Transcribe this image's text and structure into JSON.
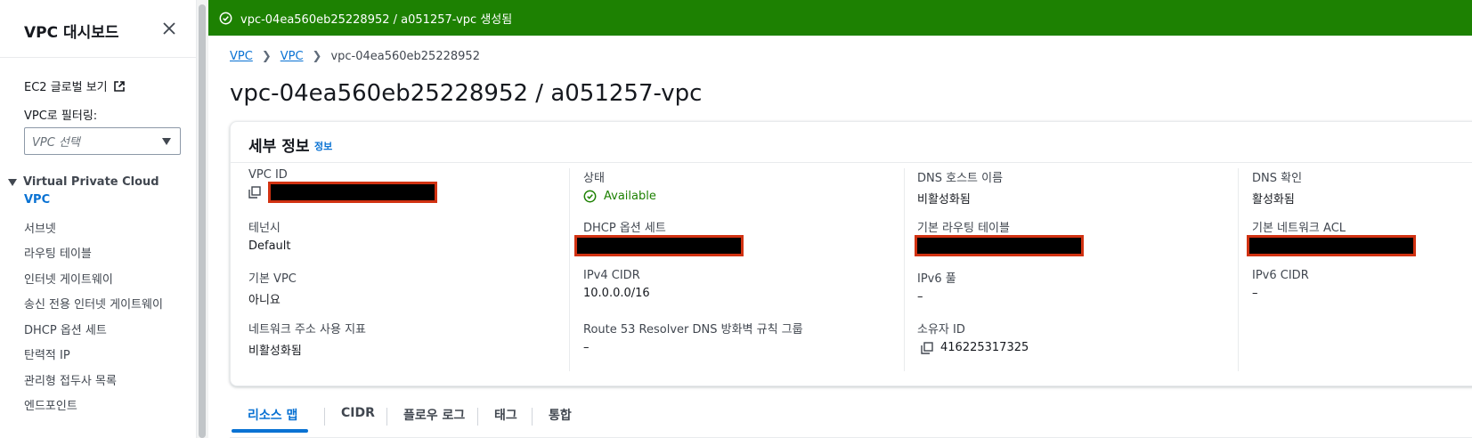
{
  "sidebar": {
    "title": "VPC 대시보드",
    "ec2_link": "EC2 글로벌 보기",
    "filter_label": "VPC로 필터링:",
    "filter_placeholder": "VPC 선택",
    "section": "Virtual Private Cloud",
    "items": [
      {
        "label": "VPC",
        "active": true
      },
      {
        "label": "서브넷"
      },
      {
        "label": "라우팅 테이블"
      },
      {
        "label": "인터넷 게이트웨이"
      },
      {
        "label": "송신 전용 인터넷 게이트웨이"
      },
      {
        "label": "DHCP 옵션 세트"
      },
      {
        "label": "탄력적 IP"
      },
      {
        "label": "관리형 접두사 목록"
      },
      {
        "label": "엔드포인트"
      }
    ]
  },
  "flash": {
    "message": "vpc-04ea560eb25228952 / a051257-vpc 생성됨",
    "color": "#1d8102"
  },
  "breadcrumb": {
    "items": [
      "VPC",
      "VPC"
    ],
    "current": "vpc-04ea560eb25228952"
  },
  "page": {
    "title": "vpc-04ea560eb25228952 / a051257-vpc"
  },
  "details": {
    "title": "세부 정보",
    "info_link": "정보",
    "col1": {
      "vpc_id_label": "VPC ID",
      "tenancy_label": "테넌시",
      "tenancy_value": "Default",
      "default_vpc_label": "기본 VPC",
      "default_vpc_value": "아니요",
      "net_addr_label": "네트워크 주소 사용 지표",
      "net_addr_value": "비활성화됨"
    },
    "col2": {
      "state_label": "상태",
      "state_value": "Available",
      "dhcp_label": "DHCP 옵션 세트",
      "ipv4_label": "IPv4 CIDR",
      "ipv4_value": "10.0.0.0/16",
      "route53_label": "Route 53 Resolver DNS 방화벽 규칙 그룹",
      "route53_value": "–"
    },
    "col3": {
      "dns_host_label": "DNS 호스트 이름",
      "dns_host_value": "비활성화됨",
      "main_rt_label": "기본 라우팅 테이블",
      "ipv6_pool_label": "IPv6 풀",
      "ipv6_pool_value": "–",
      "owner_label": "소유자 ID",
      "owner_value": "416225317325"
    },
    "col4": {
      "dns_res_label": "DNS 확인",
      "dns_res_value": "활성화됨",
      "main_acl_label": "기본 네트워크 ACL",
      "ipv6_cidr_label": "IPv6 CIDR",
      "ipv6_cidr_value": "–"
    }
  },
  "tabs": [
    "리소스 맵",
    "CIDR",
    "플로우 로그",
    "태그",
    "통합"
  ],
  "colors": {
    "accent": "#0972d3",
    "success": "#1d8102",
    "redact_border": "#d13212"
  }
}
